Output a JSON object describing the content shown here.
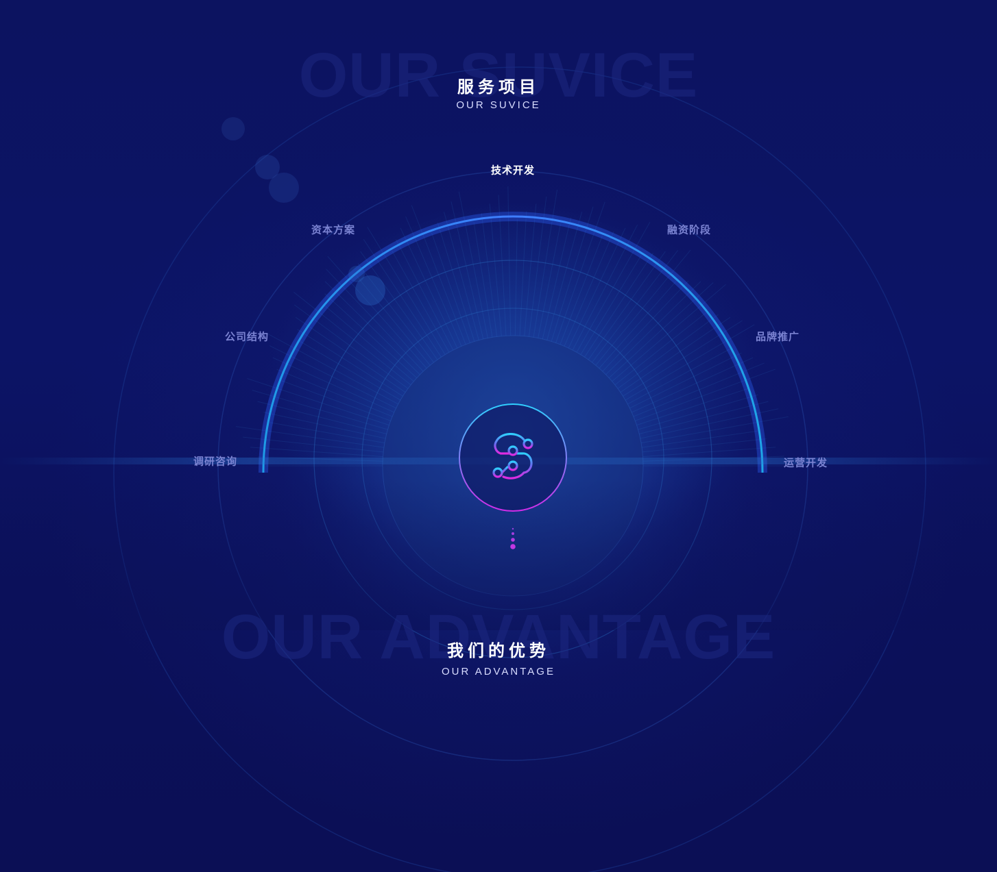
{
  "section_services": {
    "watermark": "OUR SUVICE",
    "title_cn": "服务项目",
    "title_en": "OUR SUVICE",
    "items": [
      {
        "label": "技术开发",
        "active": true
      },
      {
        "label": "资本方案",
        "active": false
      },
      {
        "label": "融资阶段",
        "active": false
      },
      {
        "label": "公司结构",
        "active": false
      },
      {
        "label": "品牌推广",
        "active": false
      },
      {
        "label": "调研咨询",
        "active": false
      },
      {
        "label": "运营开发",
        "active": false
      }
    ]
  },
  "section_advantage": {
    "watermark": "OUR ADVANTAGE",
    "title_cn": "我们的优势",
    "title_en": "OUR ADVANTAGE"
  },
  "colors": {
    "background": "#0b1158",
    "arc_cyan": "#2ec6ff",
    "arc_blue": "#3a5bff",
    "logo_cyan": "#2fd0ff",
    "logo_magenta": "#d12ce8",
    "label_inactive": "#7b83d2",
    "label_active": "#ffffff"
  },
  "icons": {
    "center_logo": "s-circuit-logo-icon",
    "scroll_indicator": "scroll-dots-icon"
  }
}
